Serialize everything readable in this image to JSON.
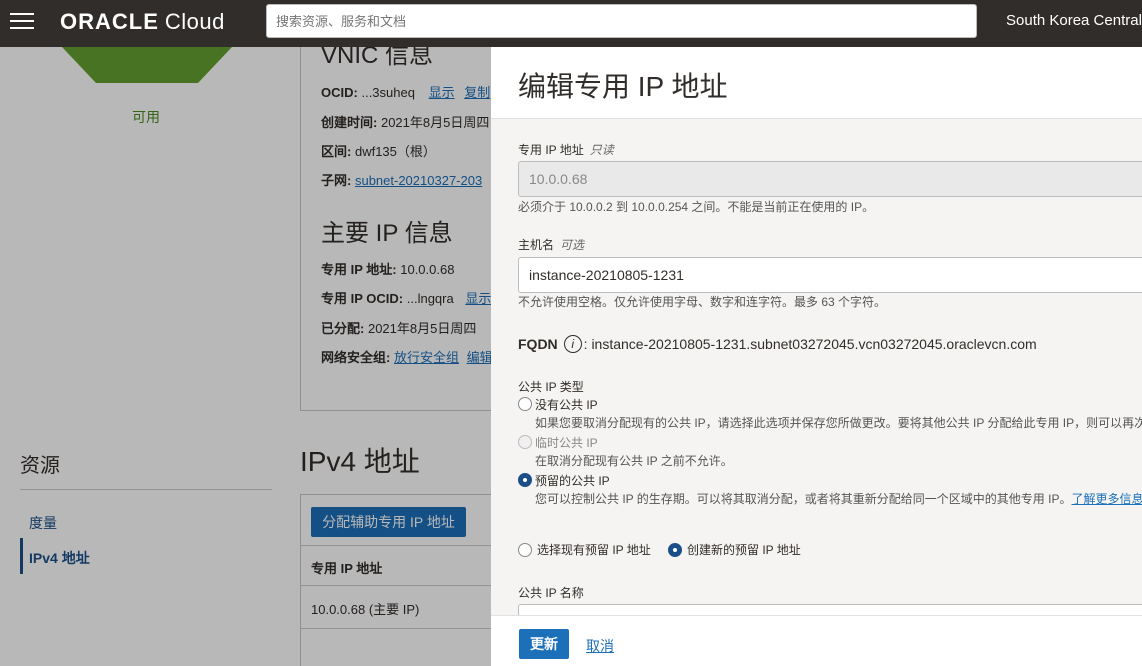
{
  "header": {
    "logo_brand": "ORACLE",
    "logo_product": "Cloud",
    "search_placeholder": "搜索资源、服务和文档",
    "region": "South Korea Central"
  },
  "background": {
    "status": "可用",
    "vnic_heading": "VNIC 信息",
    "vnic_rows": [
      {
        "label": "OCID:",
        "value": "...3suheq",
        "link1": "显示",
        "link2": "复制"
      },
      {
        "label": "创建时间:",
        "value": "2021年8月5日周四"
      },
      {
        "label": "区间:",
        "value": "dwf135（根）"
      },
      {
        "label": "子网:",
        "link": "subnet-20210327-203"
      }
    ],
    "primary_ip_heading": "主要 IP 信息",
    "primary_ip_rows": [
      {
        "label": "专用 IP 地址:",
        "value": "10.0.0.68"
      },
      {
        "label": "专用 IP OCID:",
        "value": "...lngqra",
        "link": "显示"
      },
      {
        "label": "已分配:",
        "value": "2021年8月5日周四"
      },
      {
        "label": "网络安全组:",
        "link": "放行安全组",
        "link2": "编辑"
      }
    ],
    "resources_title": "资源",
    "resources_items": [
      "度量",
      "IPv4 地址"
    ],
    "ipv4_title": "IPv4 地址",
    "assign_button": "分配辅助专用 IP 地址",
    "table_header": "专用 IP 地址",
    "table_row": "10.0.0.68 (主要 IP)"
  },
  "panel": {
    "title": "编辑专用 IP 地址",
    "private_ip": {
      "label": "专用 IP 地址",
      "tag": "只读",
      "value": "10.0.0.68",
      "hint": "必须介于 10.0.0.2 到 10.0.0.254 之间。不能是当前正在使用的 IP。"
    },
    "hostname": {
      "label": "主机名",
      "tag": "可选",
      "value": "instance-20210805-1231",
      "hint": "不允许使用空格。仅允许使用字母、数字和连字符。最多 63 个字符。"
    },
    "fqdn": {
      "label": "FQDN",
      "value": ": instance-20210805-1231.subnet03272045.vcn03272045.oraclevcn.com"
    },
    "public_ip_type": {
      "label": "公共 IP 类型",
      "options": [
        {
          "label": "没有公共 IP",
          "desc": "如果您要取消分配现有的公共 IP，请选择此选项并保存您所做更改。要将其他公共 IP 分配给此专用 IP，则可以再次",
          "selected": false,
          "disabled": false
        },
        {
          "label": "临时公共 IP",
          "desc": "在取消分配现有公共 IP 之前不允许。",
          "selected": false,
          "disabled": true
        },
        {
          "label": "预留的公共 IP",
          "desc": "您可以控制公共 IP 的生存期。可以将其取消分配，或者将其重新分配给同一个区域中的其他专用 IP。",
          "desc_link": "了解更多信息",
          "selected": true,
          "disabled": false
        }
      ]
    },
    "reserved_choice": {
      "option_existing": "选择现有预留 IP 地址",
      "option_new": "创建新的预留 IP 地址",
      "selected": "new"
    },
    "public_ip_name_label": "公共 IP 名称",
    "footer": {
      "update_button": "更新",
      "cancel_link": "取消"
    }
  }
}
